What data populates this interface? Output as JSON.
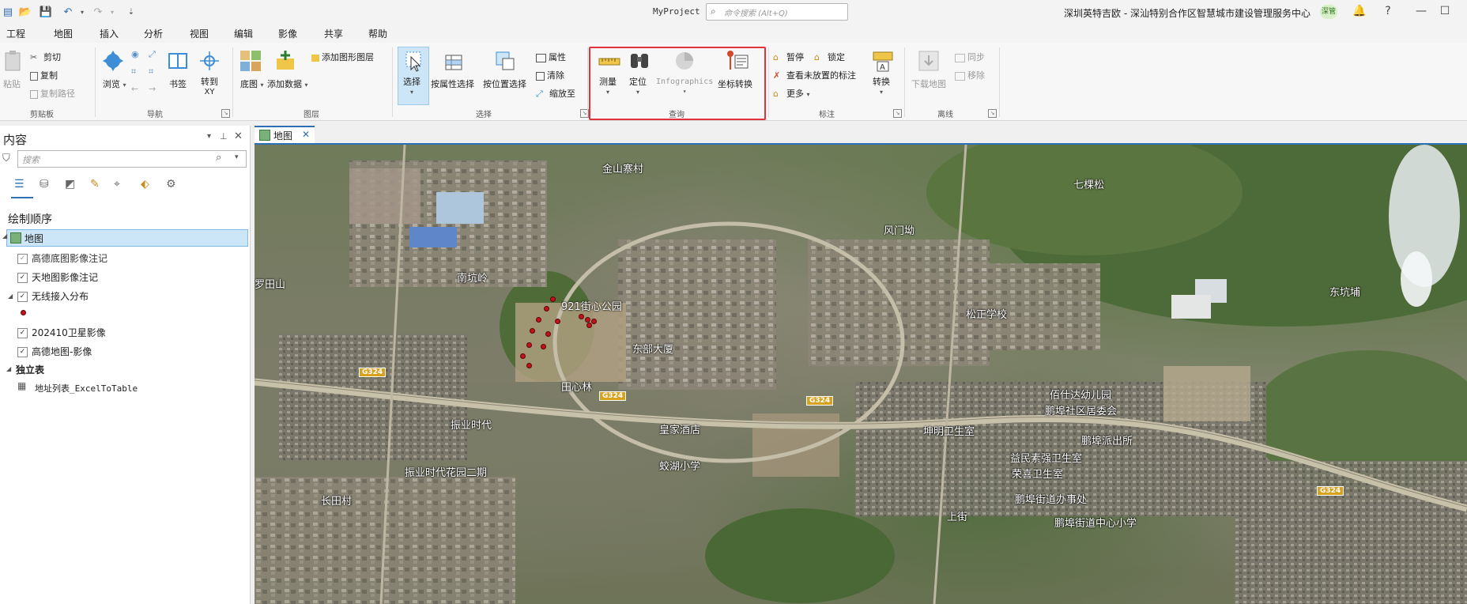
{
  "titlebar": {
    "app_title": "MyProject",
    "command_search_placeholder": "命令搜索 (Alt+Q)",
    "org_name": "深圳英特吉欧 - 深汕特别合作区智慧城市建设管理服务中心",
    "user_initials": "深管",
    "help_label": "?"
  },
  "menu": {
    "tabs": [
      "工程",
      "地图",
      "插入",
      "分析",
      "视图",
      "编辑",
      "影像",
      "共享",
      "帮助"
    ],
    "active": "地图"
  },
  "ribbon": {
    "clipboard": {
      "label": "剪贴板",
      "paste": "粘贴",
      "cut": "剪切",
      "copy": "复制",
      "copy_path": "复制路径"
    },
    "navigate": {
      "label": "导航",
      "explore": "浏览",
      "bookmark": "书签",
      "goto": "转到",
      "goto_sub": "XY"
    },
    "layer": {
      "label": "图层",
      "basemap": "底图",
      "add_data": "添加数据",
      "add_graphics": "添加图形图层"
    },
    "selection": {
      "label": "选择",
      "select": "选择",
      "by_attr": "按属性选择",
      "by_loc": "按位置选择",
      "attributes": "属性",
      "clear": "清除",
      "zoom_to": "缩放至"
    },
    "inquiry": {
      "label": "查询",
      "measure": "测量",
      "locate": "定位",
      "infographics": "Infographics",
      "coord_convert": "坐标转换"
    },
    "labeling": {
      "label": "标注",
      "pause": "暂停",
      "lock": "锁定",
      "unplaced": "查看未放置的标注",
      "more": "更多",
      "convert": "转换"
    },
    "offline": {
      "label": "离线",
      "download": "下载地图",
      "sync": "同步",
      "remove": "移除"
    }
  },
  "contents": {
    "title": "内容",
    "search_placeholder": "搜索",
    "drawing_order": "绘制顺序",
    "map_name": "地图",
    "layers": [
      {
        "name": "高德底图影像注记",
        "checked": true,
        "dim": true
      },
      {
        "name": "天地图影像注记",
        "checked": true
      },
      {
        "name": "无线接入分布",
        "checked": true
      },
      {
        "name": "202410卫星影像",
        "checked": true
      },
      {
        "name": "高德地图-影像",
        "checked": true
      }
    ],
    "standalone_tables": "独立表",
    "table_name": "地址列表_ExcelToTable"
  },
  "map": {
    "tab_label": "地图",
    "labels": {
      "jinshan": "金山寨村",
      "qikesong": "七棵松",
      "fengmenao": "风门坳",
      "luotianshan": "罗田山",
      "nankengling": "南坑岭",
      "park921": "921街心公园",
      "dongbudasha": "东部大厦",
      "songzheng": "松正学校",
      "dongkengpu": "东坑埔",
      "huangjia": "皇家酒店",
      "kunming": "坤明卫生室",
      "baishida": "佰仕达幼儿园",
      "pengpu_comm": "鹏埠社区居委会",
      "pengpu_police": "鹏埠派出所",
      "yimin": "益民素强卫生室",
      "rongxi": "荣喜卫生室",
      "zhenye": "振业时代",
      "zhenye2": "振业时代花园二期",
      "jiaowei": "蛟湖小学",
      "changyong": "长田村",
      "pengpu_office": "鹏埠街道办事处",
      "pengpu_school": "鹏埠街道中心小学",
      "shangjie": "上街",
      "fengmen2": "田心林"
    },
    "roads": {
      "g324a": "G324",
      "g324b": "G324",
      "g324c": "G324",
      "g324d": "G324"
    }
  },
  "colors": {
    "accent": "#2f6fb5",
    "highlight_box": "#e0333c",
    "point": "#c4121b"
  }
}
